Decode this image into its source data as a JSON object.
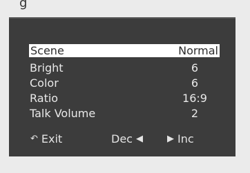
{
  "osd": {
    "rows": [
      {
        "label": "Scene",
        "value": "Normal"
      },
      {
        "label": "Bright",
        "value": "6"
      },
      {
        "label": "Color",
        "value": "6"
      },
      {
        "label": "Ratio",
        "value": "16:9"
      },
      {
        "label": "Talk Volume",
        "value": "2"
      }
    ],
    "footer": {
      "exit_label": "Exit",
      "dec_label": "Dec",
      "inc_label": "Inc"
    }
  }
}
